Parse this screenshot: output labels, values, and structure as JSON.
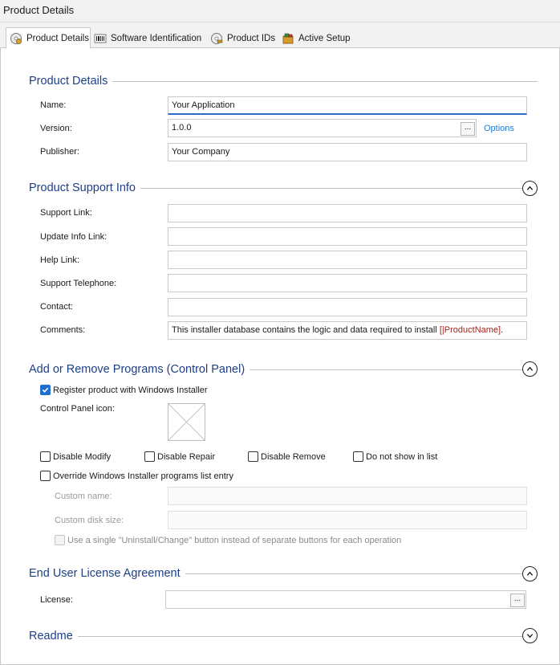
{
  "window": {
    "title": "Product Details"
  },
  "tabs": [
    {
      "label": "Product Details",
      "icon": "cd-gear-icon"
    },
    {
      "label": "Software Identification",
      "icon": "barcode-icon"
    },
    {
      "label": "Product IDs",
      "icon": "cd-key-icon"
    },
    {
      "label": "Active Setup",
      "icon": "package-icon"
    }
  ],
  "product_details": {
    "heading": "Product Details",
    "name_label": "Name:",
    "name_value": "Your Application",
    "version_label": "Version:",
    "version_value": "1.0.0",
    "version_browse": "...",
    "options_link": "Options",
    "publisher_label": "Publisher:",
    "publisher_value": "Your Company"
  },
  "support_info": {
    "heading": "Product Support Info",
    "support_link_label": "Support Link:",
    "support_link_value": "",
    "update_info_label": "Update Info Link:",
    "update_info_value": "",
    "help_link_label": "Help Link:",
    "help_link_value": "",
    "telephone_label": "Support Telephone:",
    "telephone_value": "",
    "contact_label": "Contact:",
    "contact_value": "",
    "comments_label": "Comments:",
    "comments_prefix": "This installer database contains the logic and data required to install ",
    "comments_property": "[|ProductName]",
    "comments_suffix": "."
  },
  "arp": {
    "heading": "Add or Remove Programs (Control Panel)",
    "register_label": "Register product with Windows Installer",
    "register_checked": true,
    "control_panel_icon_label": "Control Panel icon:",
    "disable_modify": "Disable Modify",
    "disable_repair": "Disable Repair",
    "disable_remove": "Disable Remove",
    "do_not_show": "Do not show in list",
    "override_label": "Override Windows Installer programs list entry",
    "custom_name_label": "Custom name:",
    "custom_name_value": "",
    "custom_disk_label": "Custom disk size:",
    "custom_disk_value": "",
    "single_button_label": "Use a single \"Uninstall/Change\" button instead of separate buttons for each operation"
  },
  "eula": {
    "heading": "End User License Agreement",
    "license_label": "License:",
    "license_value": "",
    "license_browse": "..."
  },
  "readme": {
    "heading": "Readme"
  },
  "colors": {
    "section_heading": "#1d3f86",
    "link": "#1e7bd6",
    "checkbox_checked": "#1e6fd0",
    "property_text": "#a5211a"
  }
}
